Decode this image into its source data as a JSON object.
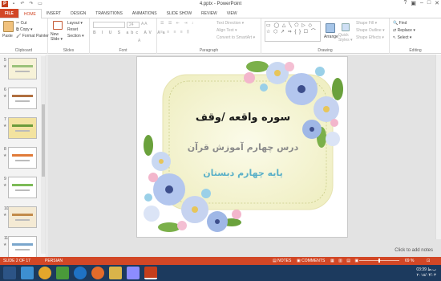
{
  "window": {
    "title": "4.pptx - PowerPoint",
    "app_logo_text": "P"
  },
  "tabs": [
    "FILE",
    "HOME",
    "INSERT",
    "DESIGN",
    "TRANSITIONS",
    "ANIMATIONS",
    "SLIDE SHOW",
    "REVIEW",
    "VIEW"
  ],
  "ribbon": {
    "clipboard": {
      "paste": "Paste",
      "cut": "Cut",
      "copy": "Copy ▾",
      "format_painter": "Format Painter",
      "label": "Clipboard"
    },
    "slides": {
      "new_slide": "New Slide ▾",
      "layout": "Layout ▾",
      "reset": "Reset",
      "section": "Section ▾",
      "label": "Slides"
    },
    "font": {
      "size": "24",
      "label": "Font"
    },
    "paragraph": {
      "text_direction": "Text Direction ▾",
      "align_text": "Align Text ▾",
      "convert_smartart": "Convert to SmartArt ▾",
      "label": "Paragraph"
    },
    "drawing": {
      "arrange": "Arrange",
      "quick_styles": "Quick Styles ▾",
      "shape_fill": "Shape Fill ▾",
      "shape_outline": "Shape Outline ▾",
      "shape_effects": "Shape Effects ▾",
      "label": "Drawing"
    },
    "editing": {
      "find": "Find",
      "replace": "Replace ▾",
      "select": "Select ▾",
      "label": "Editing"
    }
  },
  "thumbnails": [
    {
      "num": "5",
      "bg": "#f7f2d8",
      "accent": "#9bc27a"
    },
    {
      "num": "6",
      "bg": "#ffffff",
      "accent": "#b07040"
    },
    {
      "num": "7",
      "bg": "#f3e3a0",
      "accent": "#6b9b3a"
    },
    {
      "num": "8",
      "bg": "#ffffff",
      "accent": "#e07b39"
    },
    {
      "num": "9",
      "bg": "#ffffff",
      "accent": "#7dbb57"
    },
    {
      "num": "10",
      "bg": "#f4ead4",
      "accent": "#c28a4a"
    },
    {
      "num": "11",
      "bg": "#ffffff",
      "accent": "#7aa6cc"
    }
  ],
  "slide": {
    "line1": "سوره واقعه /وقف",
    "line2": "درس چهارم آموزش قرآن",
    "line3": "پایه چهارم دبستان"
  },
  "notes_placeholder": "Click to add notes",
  "status": {
    "slide_of": "SLIDE 2 OF 17",
    "language": "PERSIAN",
    "notes": "NOTES",
    "comments": "COMMENTS",
    "zoom": "69 %"
  },
  "clock": {
    "time": "03:39 ب.ظ",
    "date": "۲۰۱۸/۰۴/۰۳"
  },
  "colors": {
    "accent": "#d24726",
    "taskbar": "#1c3a5e",
    "slide_title": "#1a1a1a",
    "slide_line2": "#8c8c8c",
    "slide_line3": "#5ab0c8"
  }
}
